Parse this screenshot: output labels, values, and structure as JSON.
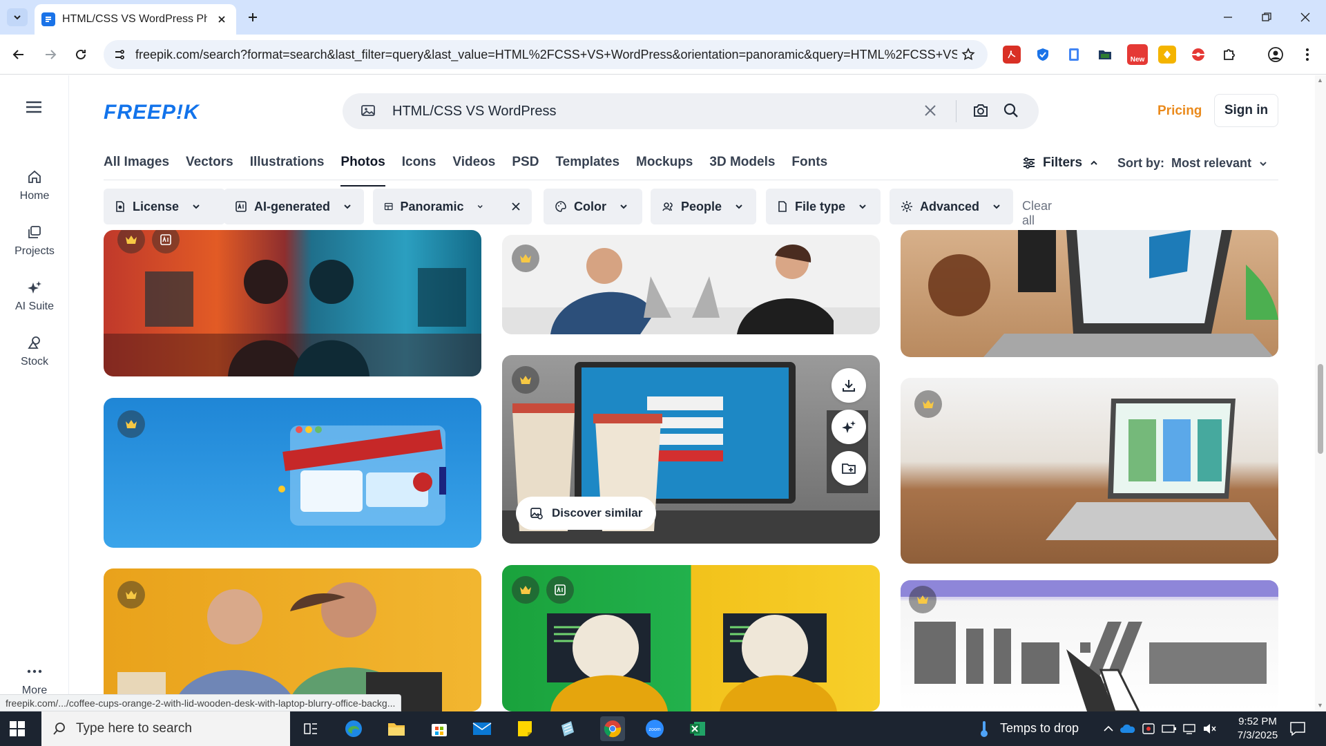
{
  "browser": {
    "tab_title": "HTML/CSS VS WordPress Photo",
    "url": "freepik.com/search?format=search&last_filter=query&last_value=HTML%2FCSS+VS+WordPress&orientation=panoramic&query=HTML%2FCSS+VS+...",
    "status_url": "freepik.com/.../coffee-cups-orange-2-with-lid-wooden-desk-with-laptop-blurry-office-backg..."
  },
  "site": {
    "logo": "FREEP!K",
    "search_value": "HTML/CSS VS WordPress",
    "pricing": "Pricing",
    "signin": "Sign in"
  },
  "leftnav": [
    {
      "label": "Home",
      "icon": "home-icon"
    },
    {
      "label": "Projects",
      "icon": "projects-icon"
    },
    {
      "label": "AI Suite",
      "icon": "ai-suite-icon"
    },
    {
      "label": "Stock",
      "icon": "stock-icon"
    }
  ],
  "leftnav_more": "More",
  "categories": [
    "All Images",
    "Vectors",
    "Illustrations",
    "Photos",
    "Icons",
    "Videos",
    "PSD",
    "Templates",
    "Mockups",
    "3D Models",
    "Fonts"
  ],
  "active_category": "Photos",
  "filters_label": "Filters",
  "sort": {
    "label": "Sort by:",
    "value": "Most relevant"
  },
  "chips": [
    "License",
    "AI-generated",
    "Panoramic",
    "Color",
    "People",
    "File type",
    "Advanced"
  ],
  "clear_all": "Clear all",
  "hover_card": {
    "discover_label": "Discover similar"
  },
  "taskbar": {
    "search_placeholder": "Type here to search",
    "weather": "Temps to drop",
    "time": "9:52 PM",
    "date": "7/3/2025"
  },
  "colors": {
    "brand": "#1273eb",
    "pricing": "#ea8a1c"
  }
}
